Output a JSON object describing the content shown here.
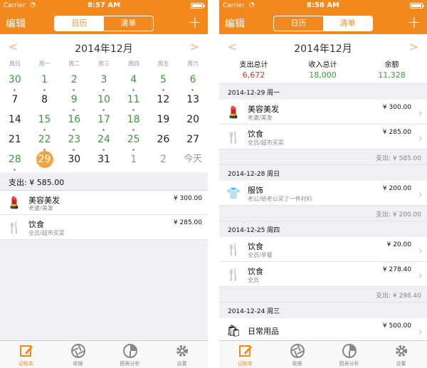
{
  "colors": {
    "accent": "#f2891e",
    "green": "#3a9a3a",
    "red": "#e03030"
  },
  "screen1": {
    "status": {
      "carrier": "Carrier",
      "time": "8:57 AM"
    },
    "nav": {
      "edit": "编辑",
      "seg_calendar": "日历",
      "seg_list": "清单",
      "add": "+"
    },
    "month": {
      "prev": "<",
      "title": "2014年12月",
      "next": ">"
    },
    "weekdays": [
      "周日",
      "周一",
      "周二",
      "周三",
      "周四",
      "周五",
      "周六"
    ],
    "days": [
      {
        "label": "30",
        "state": "hasdot"
      },
      {
        "label": "1",
        "state": "hasdot"
      },
      {
        "label": "2",
        "state": "hasdot"
      },
      {
        "label": "3",
        "state": "hasdot"
      },
      {
        "label": "4",
        "state": "hasdot"
      },
      {
        "label": "5",
        "state": "hasdot"
      },
      {
        "label": "6",
        "state": "hasdot"
      },
      {
        "label": "7",
        "state": "plain"
      },
      {
        "label": "8",
        "state": "plain"
      },
      {
        "label": "9",
        "state": "hasdot"
      },
      {
        "label": "10",
        "state": "hasdot"
      },
      {
        "label": "11",
        "state": "hasdot"
      },
      {
        "label": "12",
        "state": "plain"
      },
      {
        "label": "13",
        "state": "plain"
      },
      {
        "label": "14",
        "state": "plain"
      },
      {
        "label": "15",
        "state": "hasdot"
      },
      {
        "label": "16",
        "state": "hasdot"
      },
      {
        "label": "17",
        "state": "hasdot"
      },
      {
        "label": "18",
        "state": "hasdot"
      },
      {
        "label": "19",
        "state": "plain"
      },
      {
        "label": "20",
        "state": "plain"
      },
      {
        "label": "21",
        "state": "plain"
      },
      {
        "label": "22",
        "state": "hasdot"
      },
      {
        "label": "23",
        "state": "hasdot"
      },
      {
        "label": "24",
        "state": "hasdot"
      },
      {
        "label": "25",
        "state": "hasdot"
      },
      {
        "label": "26",
        "state": "plain"
      },
      {
        "label": "27",
        "state": "plain"
      },
      {
        "label": "28",
        "state": "hasdot"
      },
      {
        "label": "29",
        "state": "sel"
      },
      {
        "label": "30",
        "state": "plain"
      },
      {
        "label": "31",
        "state": "plain"
      },
      {
        "label": "1",
        "state": "dim"
      },
      {
        "label": "2",
        "state": "dim"
      },
      {
        "label": "今天",
        "state": "today"
      }
    ],
    "summary": "支出: ¥ 585.00",
    "entries": [
      {
        "icon": "lipstick-icon",
        "glyph": "💄",
        "title": "美容美发",
        "sub": "老婆/美发",
        "amount": "¥ 300.00"
      },
      {
        "icon": "fork-knife-icon",
        "glyph": "🍴",
        "title": "饮食",
        "sub": "全员/超市买菜",
        "amount": "¥ 285.00"
      }
    ]
  },
  "screen2": {
    "status": {
      "carrier": "Carrier",
      "time": "8:58 AM"
    },
    "nav": {
      "edit": "编辑",
      "seg_calendar": "日历",
      "seg_list": "清单",
      "add": "+"
    },
    "month": {
      "prev": "<",
      "title": "2014年12月",
      "next": ">"
    },
    "totals": [
      {
        "label": "支出总计",
        "value": "6,672",
        "color": "#e03030"
      },
      {
        "label": "收入总计",
        "value": "18,000",
        "color": "#3a9a3a"
      },
      {
        "label": "余额",
        "value": "11,328",
        "color": "#3a9a3a"
      }
    ],
    "days": [
      {
        "header": "2014-12-29 周一",
        "items": [
          {
            "icon": "lipstick-icon",
            "glyph": "💄",
            "title": "美容美发",
            "sub": "老婆/美发",
            "amount": "¥ 300.00"
          },
          {
            "icon": "fork-knife-icon",
            "glyph": "🍴",
            "title": "饮食",
            "sub": "全员/超市买菜",
            "amount": "¥ 285.00"
          }
        ],
        "sum": "支出: ¥ 585.00"
      },
      {
        "header": "2014-12-28 周日",
        "items": [
          {
            "icon": "shirt-icon",
            "glyph": "👕",
            "title": "服饰",
            "sub": "老公/给老公买了一件衬衫",
            "amount": "¥ 200.00"
          }
        ],
        "sum": "支出: ¥ 200.00"
      },
      {
        "header": "2014-12-25 周四",
        "items": [
          {
            "icon": "fork-knife-icon",
            "glyph": "🍴",
            "title": "饮食",
            "sub": "全员/早餐",
            "amount": "¥ 20.00"
          },
          {
            "icon": "fork-knife-icon",
            "glyph": "🍴",
            "title": "饮食",
            "sub": "全员",
            "amount": "¥ 278.40"
          }
        ],
        "sum": "支出: ¥ 298.40"
      },
      {
        "header": "2014-12-24 周三",
        "items": [
          {
            "icon": "shopping-bag-icon",
            "glyph": "🛍",
            "title": "日常用品",
            "sub": "",
            "amount": "¥ 500.00"
          }
        ],
        "sum": ""
      }
    ]
  },
  "tabs": [
    {
      "label": "记帐本",
      "icon": "notebook-pen-icon"
    },
    {
      "label": "收据",
      "icon": "aperture-icon"
    },
    {
      "label": "图表分析",
      "icon": "pie-chart-icon"
    },
    {
      "label": "设置",
      "icon": "gear-icon"
    }
  ]
}
